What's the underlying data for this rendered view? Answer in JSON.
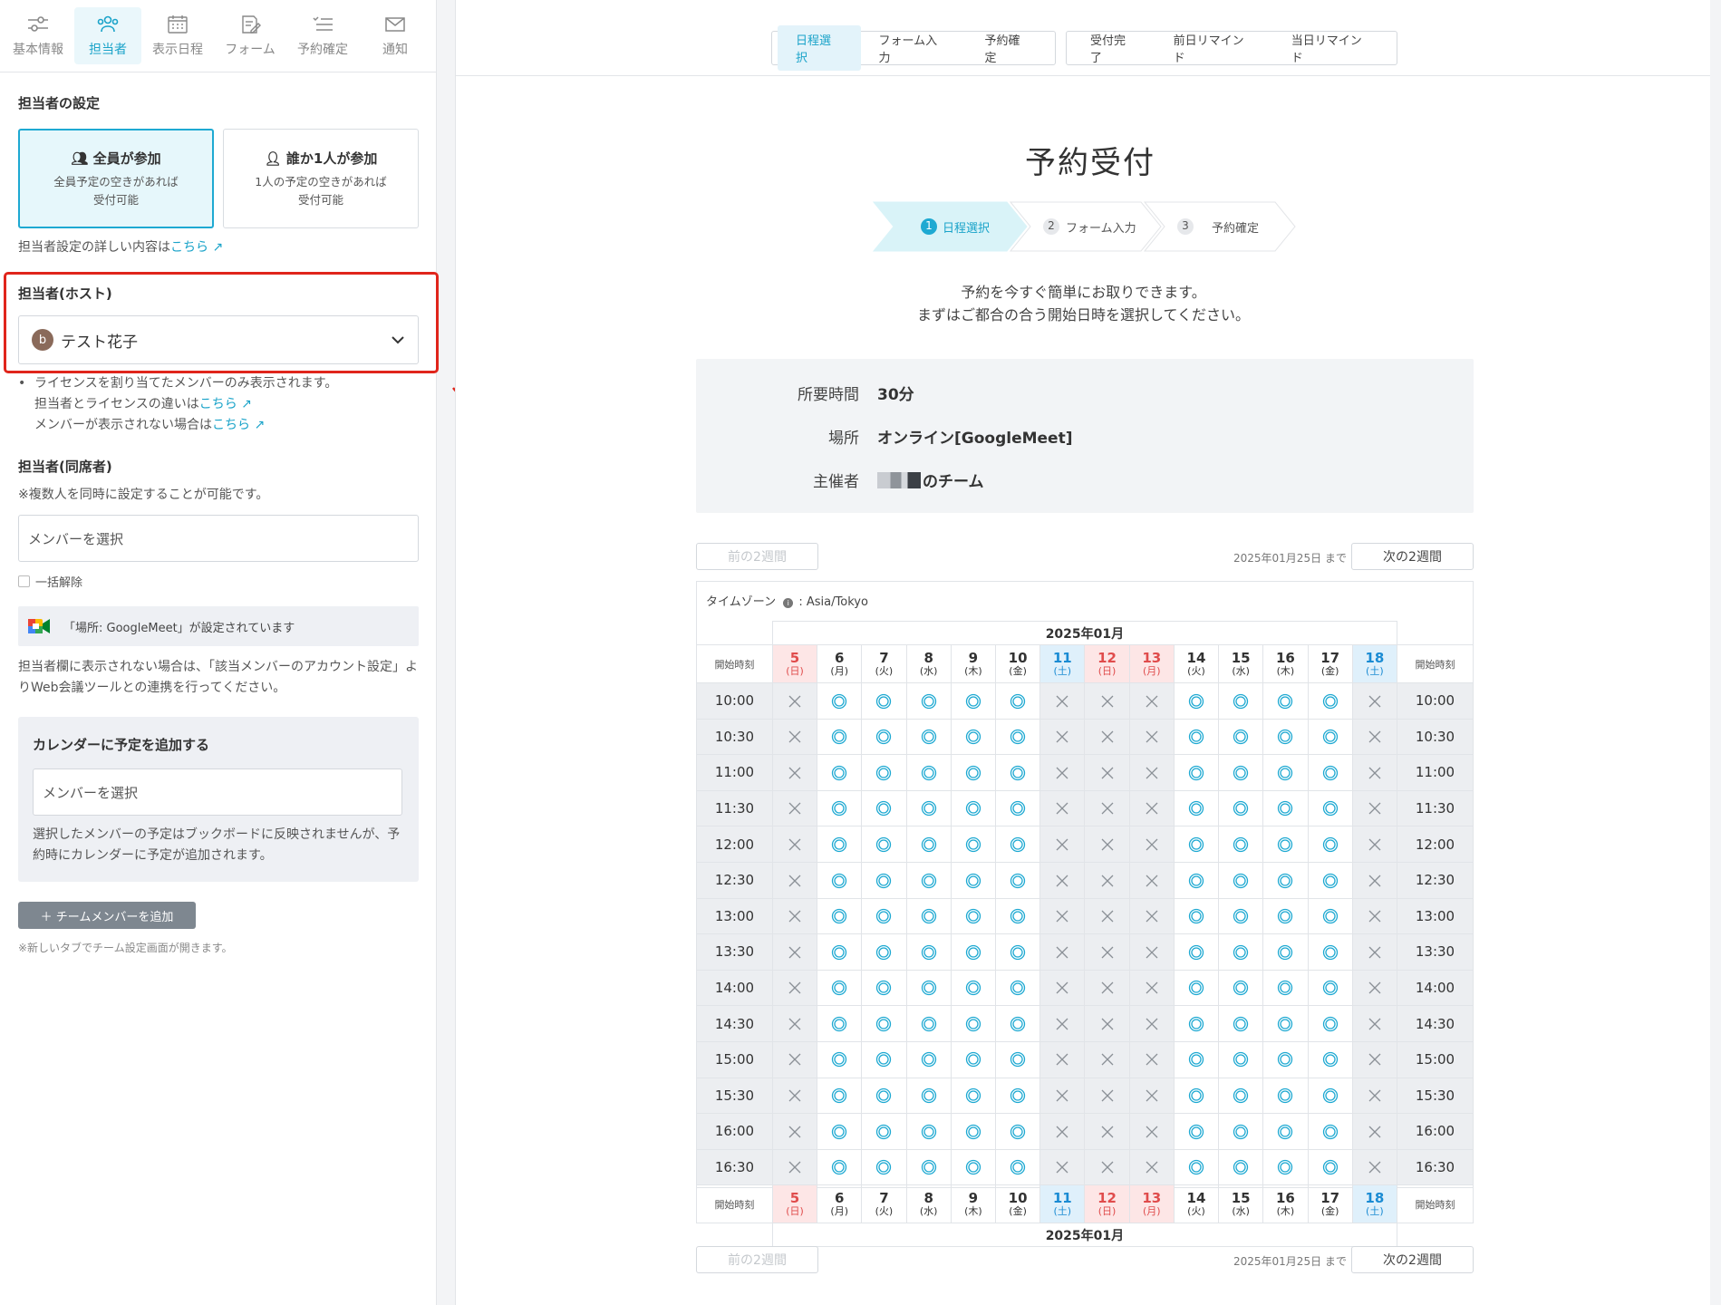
{
  "left": {
    "tabs": [
      {
        "label": "基本情報",
        "icon": "sliders-icon"
      },
      {
        "label": "担当者",
        "icon": "people-icon"
      },
      {
        "label": "表示日程",
        "icon": "calendar-icon"
      },
      {
        "label": "フォーム",
        "icon": "edit-form-icon"
      },
      {
        "label": "予約確定",
        "icon": "checklist-icon"
      },
      {
        "label": "通知",
        "icon": "mail-icon"
      }
    ],
    "assign_title": "担当者の設定",
    "option_all": {
      "title": "全員が参加",
      "desc1": "全員予定の空きがあれば",
      "desc2": "受付可能"
    },
    "option_one": {
      "title": "誰か1人が参加",
      "desc1": "1人の予定の空きがあれば",
      "desc2": "受付可能"
    },
    "detail_prefix": "担当者設定の詳しい内容は",
    "link_here": "こちら",
    "host_label": "担当者(ホスト)",
    "host_avatar": "b",
    "host_value": "テスト花子",
    "note1": "ライセンスを割り当てたメンバーのみ表示されます。",
    "note2_prefix": "担当者とライセンスの違いは",
    "note3_prefix": "メンバーが表示されない場合は",
    "cohost_label": "担当者(同席者)",
    "cohost_note": "※複数人を同時に設定することが可能です。",
    "member_placeholder": "メンバーを選択",
    "bulk_clear": "一括解除",
    "meet_notice": "「場所: GoogleMeet」が設定されています",
    "meet_help": "担当者欄に表示されない場合は、「該当メンバーのアカウント設定」よりWeb会議ツールとの連携を行ってください。",
    "cal_title": "カレンダーに予定を追加する",
    "cal_placeholder": "メンバーを選択",
    "cal_note": "選択したメンバーの予定はブックボードに反映されませんが、予約時にカレンダーに予定が追加されます。",
    "add_member": "＋  チームメンバーを追加",
    "new_tab_note": "※新しいタブでチーム設定画面が開きます。"
  },
  "preview": {
    "steps_a": [
      "日程選択",
      "フォーム入力",
      "予約確定"
    ],
    "steps_b": [
      "受付完了",
      "前日リマインド",
      "当日リマインド"
    ],
    "title": "予約受付",
    "progress": [
      {
        "n": "1",
        "label": "日程選択"
      },
      {
        "n": "2",
        "label": "フォーム入力"
      },
      {
        "n": "3",
        "label": "予約確定"
      }
    ],
    "intro1": "予約を今すぐ簡単にお取りできます。",
    "intro2": "まずはご都合の合う開始日時を選択してください。",
    "info": [
      {
        "k": "所要時間",
        "v": "30分"
      },
      {
        "k": "場所",
        "v": "オンライン[GoogleMeet]"
      },
      {
        "k": "主催者",
        "v": "のチーム"
      }
    ],
    "prev_btn": "前の2週間",
    "next_btn": "次の2週間",
    "until": "2025年01月25日 まで",
    "timezone_label": "タイムゾーン",
    "timezone": "Asia/Tokyo",
    "month": "2025年01月",
    "start_label": "開始時刻",
    "days": [
      {
        "d": "5",
        "w": "(日)",
        "type": "sun"
      },
      {
        "d": "6",
        "w": "(月)",
        "type": ""
      },
      {
        "d": "7",
        "w": "(火)",
        "type": ""
      },
      {
        "d": "8",
        "w": "(水)",
        "type": ""
      },
      {
        "d": "9",
        "w": "(木)",
        "type": ""
      },
      {
        "d": "10",
        "w": "(金)",
        "type": ""
      },
      {
        "d": "11",
        "w": "(土)",
        "type": "sat"
      },
      {
        "d": "12",
        "w": "(日)",
        "type": "sun"
      },
      {
        "d": "13",
        "w": "(月)",
        "type": "hol"
      },
      {
        "d": "14",
        "w": "(火)",
        "type": ""
      },
      {
        "d": "15",
        "w": "(水)",
        "type": ""
      },
      {
        "d": "16",
        "w": "(木)",
        "type": ""
      },
      {
        "d": "17",
        "w": "(金)",
        "type": ""
      },
      {
        "d": "18",
        "w": "(土)",
        "type": "sat"
      }
    ],
    "times": [
      "10:00",
      "10:30",
      "11:00",
      "11:30",
      "12:00",
      "12:30",
      "13:00",
      "13:30",
      "14:00",
      "14:30",
      "15:00",
      "15:30",
      "16:00",
      "16:30"
    ],
    "availability": [
      false,
      true,
      true,
      true,
      true,
      true,
      false,
      false,
      false,
      true,
      true,
      true,
      true,
      false
    ]
  },
  "colors": {
    "accent": "#1aa3c9",
    "annotation": "#e0251b",
    "sunday": "#e04c4c",
    "saturday": "#1a8bd3"
  }
}
